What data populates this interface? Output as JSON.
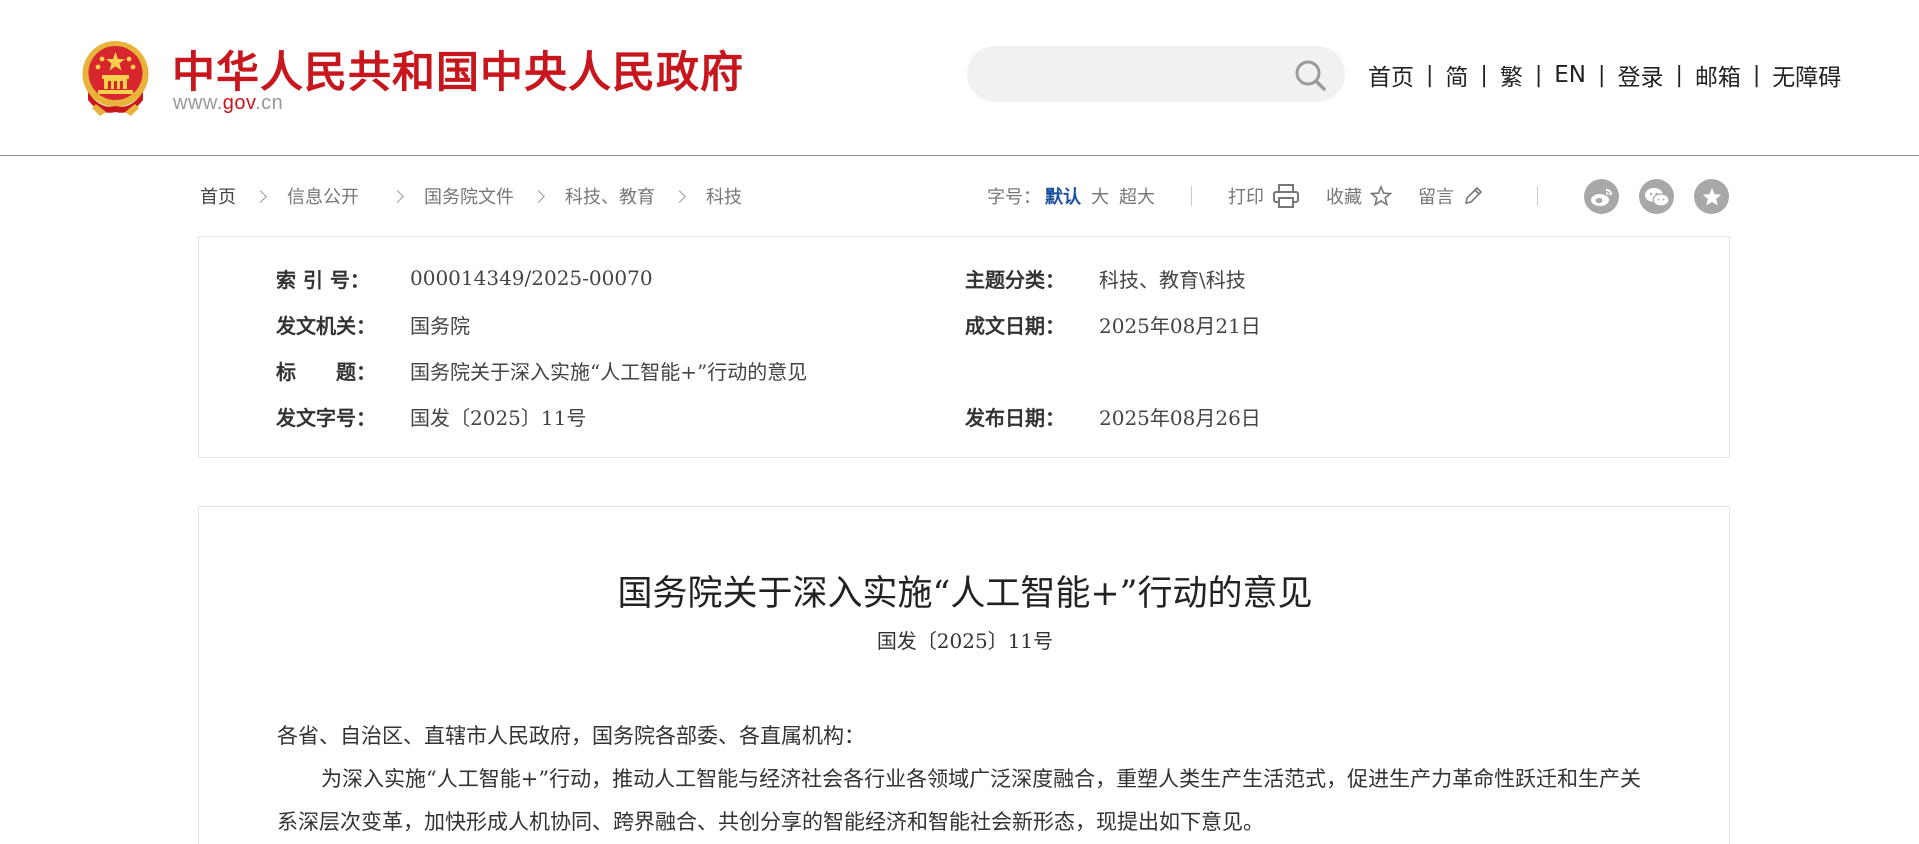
{
  "header": {
    "site_title": "中华人民共和国中央人民政府",
    "site_url_prefix": "www.",
    "site_url_brand": "gov",
    "site_url_suffix": ".cn",
    "brand_color": "#c8161d",
    "search": {
      "placeholder": "",
      "value": "",
      "icon": "search-icon"
    },
    "nav": [
      {
        "label": "首页"
      },
      {
        "label": "简"
      },
      {
        "label": "繁"
      },
      {
        "label": "EN"
      },
      {
        "label": "登录"
      },
      {
        "label": "邮箱"
      },
      {
        "label": "无障碍"
      }
    ],
    "nav_separator": "|"
  },
  "breadcrumb": [
    "首页",
    "信息公开",
    "国务院文件",
    "科技、教育",
    "科技"
  ],
  "toolbar": {
    "font_size_label": "字号：",
    "font_sizes": [
      "默认",
      "大",
      "超大"
    ],
    "active_font_size": "默认",
    "active_color": "#1a4f9c",
    "print_label": "打印",
    "favorite_label": "收藏",
    "comment_label": "留言",
    "share_icons": [
      "weibo-icon",
      "wechat-icon",
      "star-share-icon"
    ]
  },
  "info": {
    "index_no_label": "索 引 号：",
    "index_no": "000014349/2025-00070",
    "topic_label": "主题分类：",
    "topic": "科技、教育\\科技",
    "issuer_label": "发文机关：",
    "issuer": "国务院",
    "written_date_label": "成文日期：",
    "written_date": "2025年08月21日",
    "title_label": "标　　题：",
    "title": "国务院关于深入实施“人工智能+”行动的意见",
    "doc_no_label": "发文字号：",
    "doc_no": "国发〔2025〕11号",
    "publish_date_label": "发布日期：",
    "publish_date": "2025年08月26日"
  },
  "article": {
    "title": "国务院关于深入实施“人工智能+”行动的意见",
    "doc_no": "国发〔2025〕11号",
    "salutation": "各省、自治区、直辖市人民政府，国务院各部委、各直属机构：",
    "paragraph_1": "为深入实施“人工智能+”行动，推动人工智能与经济社会各行业各领域广泛深度融合，重塑人类生产生活范式，促进生产力革命性跃迁和生产关系深层次变革，加快形成人机协同、跨界融合、共创分享的智能经济和智能社会新形态，现提出如下意见。"
  }
}
